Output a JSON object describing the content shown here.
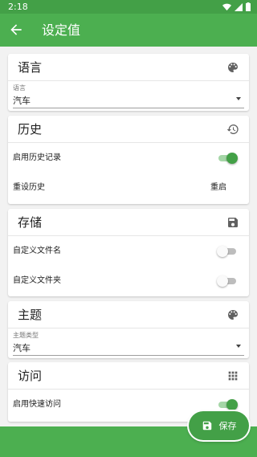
{
  "status": {
    "time": "2:18"
  },
  "appbar": {
    "title": "设定值"
  },
  "sections": {
    "language": {
      "title": "语言",
      "select_label": "语言",
      "select_value": "汽车"
    },
    "history": {
      "title": "历史",
      "enable_label": "启用历史记录",
      "enable_on": true,
      "reset_label": "重设历史",
      "reset_action": "重启"
    },
    "storage": {
      "title": "存储",
      "custom_filename_label": "自定义文件名",
      "custom_filename_on": false,
      "custom_folder_label": "自定义文件夹",
      "custom_folder_on": false
    },
    "theme": {
      "title": "主题",
      "select_label": "主题类型",
      "select_value": "汽车"
    },
    "access": {
      "title": "访问",
      "quick_access_label": "启用快速访问",
      "quick_access_on": true
    }
  },
  "fab": {
    "label": "保存"
  },
  "colors": {
    "primary": "#4caf50",
    "primary_dark": "#43a047"
  }
}
